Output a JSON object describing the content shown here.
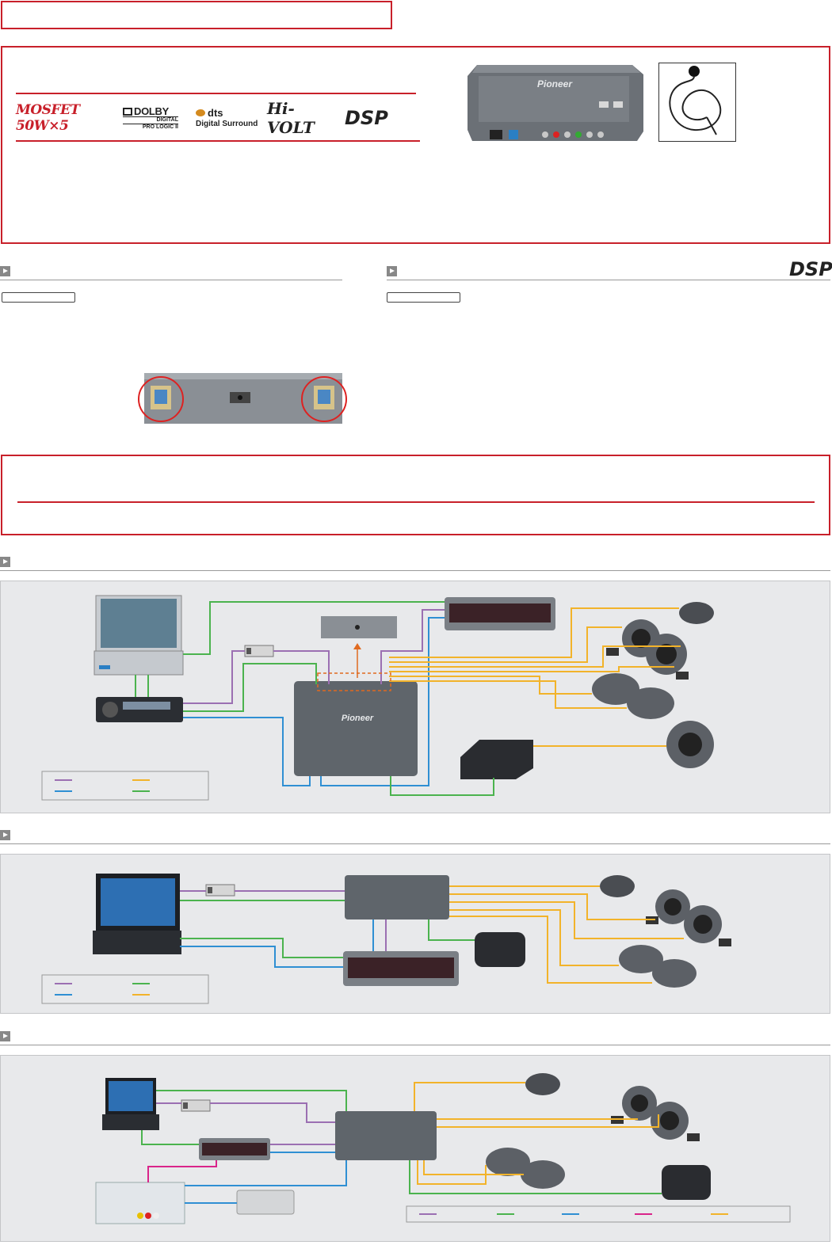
{
  "header": {
    "title": ""
  },
  "feature_logos": {
    "mosfet": "MOSFET 50W×5",
    "dolby_brand": "DOLBY",
    "dolby_digital": "DIGITAL",
    "dolby_plii": "PRO LOGIC II",
    "dts_brand": "dts",
    "dts_sub": "Digital Surround",
    "hivolt": "Hi-VOLT",
    "dsp": "DSP"
  },
  "product": {
    "brand": "Pioneer"
  },
  "sections": {
    "left_dsp_badge": "DSP"
  },
  "colors": {
    "accent_red": "#c8202a",
    "wire_purple": "#9b6fb2",
    "wire_green": "#4bb34e",
    "wire_blue": "#2f8fd3",
    "wire_orange": "#f2b32a",
    "wire_pink": "#d9248a"
  },
  "icons": [
    "play-arrow-icon",
    "play-arrow-icon",
    "play-arrow-icon",
    "play-arrow-icon",
    "play-arrow-icon"
  ]
}
